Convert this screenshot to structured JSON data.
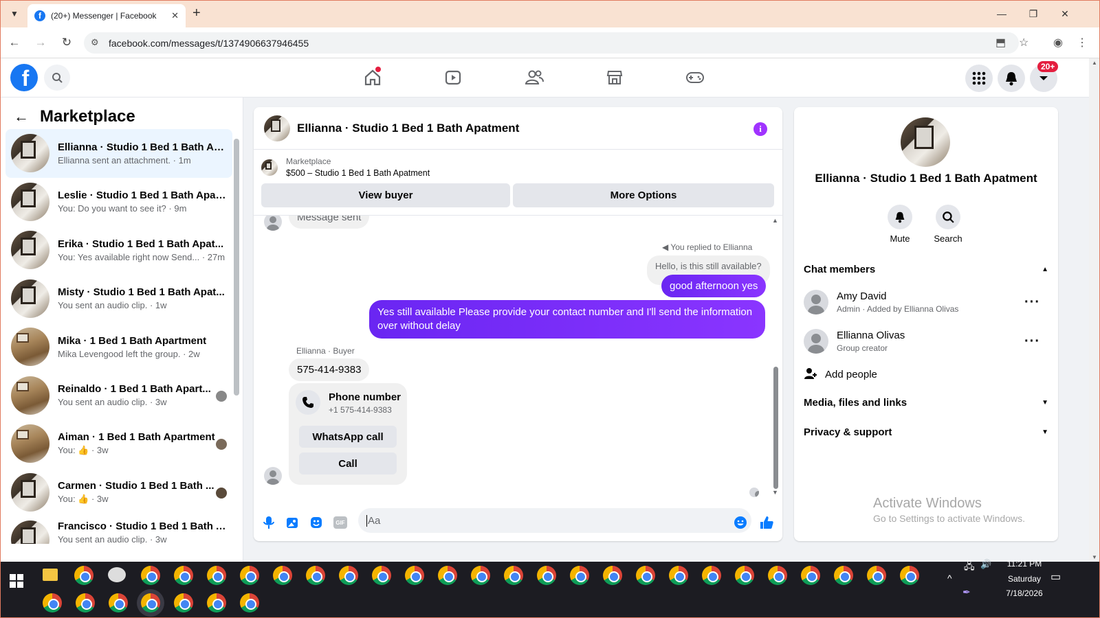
{
  "browser": {
    "tab_title": "(20+) Messenger | Facebook",
    "url": "facebook.com/messages/t/1374906637946455"
  },
  "header": {
    "notification_badge": "20+"
  },
  "sidebar": {
    "title": "Marketplace",
    "conversations": [
      {
        "name": "Ellianna · Studio 1 Bed 1 Bath Ap...",
        "preview": "Ellianna sent an attachment. · 1m",
        "active": true
      },
      {
        "name": "Leslie · Studio 1 Bed 1 Bath Apat...",
        "preview": "You: Do you want to see it? · 9m"
      },
      {
        "name": "Erika · Studio 1 Bed 1 Bath Apat...",
        "preview": "You: Yes available right now Send... · 27m"
      },
      {
        "name": "Misty · Studio 1 Bed 1 Bath Apat...",
        "preview": "You sent an audio clip. · 1w"
      },
      {
        "name": "Mika · 1 Bed 1 Bath Apartment",
        "preview": "Mika Levengood left the group. · 2w"
      },
      {
        "name": "Reinaldo · 1 Bed 1 Bath Apart...",
        "preview": "You sent an audio clip. · 3w"
      },
      {
        "name": "Aiman · 1 Bed 1 Bath Apartment",
        "preview": "You: 👍 · 3w"
      },
      {
        "name": "Carmen · Studio 1 Bed 1 Bath ...",
        "preview": "You: 👍 · 3w"
      },
      {
        "name": "Francisco · Studio 1 Bed 1 Bath A...",
        "preview": "You sent an audio clip. · 3w"
      }
    ]
  },
  "chat": {
    "title": "Ellianna · Studio 1 Bed 1 Bath Apatment",
    "marketplace_label": "Marketplace",
    "listing": "$500 – Studio 1 Bed 1 Bath Apatment",
    "view_buyer": "View buyer",
    "more_options": "More Options",
    "msg_partial": "Message sent",
    "replied_label": "You replied to Ellianna",
    "quoted": "Hello, is this still available?",
    "msg1": "good afternoon yes",
    "msg2": "Yes still available Please provide your contact number and I'll send the information over without delay",
    "sender_label": "Ellianna · Buyer",
    "phone_msg": "575-414-9383",
    "phone_card_title": "Phone number",
    "phone_card_number": "+1 575-414-9383",
    "whatsapp_call": "WhatsApp call",
    "call": "Call",
    "composer_placeholder": "Aa"
  },
  "details": {
    "name": "Ellianna · Studio 1 Bed 1 Bath Apatment",
    "mute": "Mute",
    "search": "Search",
    "chat_members": "Chat members",
    "members": [
      {
        "name": "Amy David",
        "sub": "Admin · Added by Ellianna Olivas"
      },
      {
        "name": "Ellianna Olivas",
        "sub": "Group creator"
      }
    ],
    "add_people": "Add people",
    "media": "Media, files and links",
    "privacy": "Privacy & support"
  },
  "watermark": {
    "line1": "Activate Windows",
    "line2": "Go to Settings to activate Windows."
  },
  "taskbar": {
    "time": "11:21 PM",
    "day": "Saturday",
    "date": "7/18/2026"
  }
}
